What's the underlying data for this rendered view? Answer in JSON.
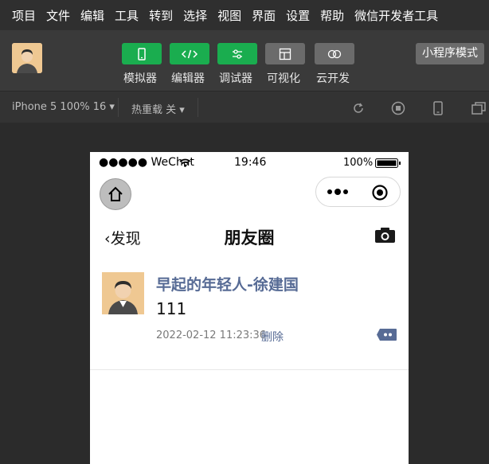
{
  "menu": [
    "项目",
    "文件",
    "编辑",
    "工具",
    "转到",
    "选择",
    "视图",
    "界面",
    "设置",
    "帮助",
    "微信开发者工具"
  ],
  "toolbar": {
    "buttons": [
      {
        "label": "模拟器",
        "icon": "phone-icon",
        "color": "#1aad4f"
      },
      {
        "label": "编辑器",
        "icon": "code-icon",
        "color": "#1aad4f"
      },
      {
        "label": "调试器",
        "icon": "debug-icon",
        "color": "#1aad4f"
      },
      {
        "label": "可视化",
        "icon": "layout-icon",
        "color": "#6b6b6b"
      },
      {
        "label": "云开发",
        "icon": "cloud-icon",
        "color": "#6b6b6b"
      }
    ],
    "mode": "小程序模式"
  },
  "subbar": {
    "device": "iPhone 5 100% 16 ▾",
    "hotreload": "热重载 关 ▾",
    "icons": [
      "refresh-icon",
      "stop-icon",
      "device-icon",
      "window-icon"
    ]
  },
  "status": {
    "carrier": "●●●●● WeChat",
    "time": "19:46",
    "battery": "100%"
  },
  "nav": {
    "back": "发现",
    "title": "朋友圈"
  },
  "post": {
    "name": "早起的年轻人-徐建国",
    "text": "111",
    "time": "2022-02-12 11:23:36",
    "delete": "删除"
  },
  "colors": {
    "accent": "#1aad4f",
    "link": "#576b95"
  }
}
